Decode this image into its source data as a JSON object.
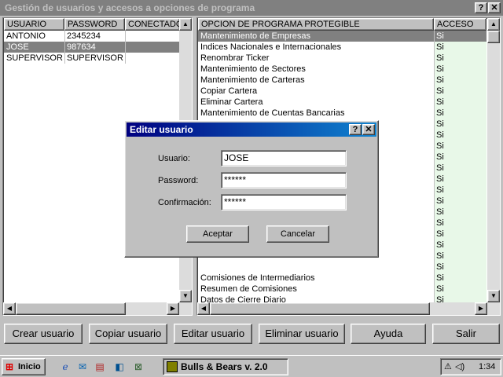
{
  "window": {
    "title": "Gestión de usuarios y accesos a opciones de programa",
    "help_btn": "?",
    "close_btn": "✕"
  },
  "users": {
    "columns": [
      "USUARIO",
      "PASSWORD",
      "CONECTADO"
    ],
    "rows": [
      {
        "user": "ANTONIO",
        "password": "2345234",
        "connected": ""
      },
      {
        "user": "JOSE",
        "password": "987634",
        "connected": ""
      },
      {
        "user": "SUPERVISOR",
        "password": "SUPERVISOR",
        "connected": ""
      }
    ]
  },
  "options": {
    "columns": [
      "OPCION DE PROGRAMA PROTEGIBLE",
      "ACCESO"
    ],
    "rows": [
      {
        "option": "Mantenimiento de Empresas",
        "access": "Si"
      },
      {
        "option": "Indices Nacionales e Internacionales",
        "access": "Si"
      },
      {
        "option": "Renombrar Ticker",
        "access": "Si"
      },
      {
        "option": "Mantenimiento de Sectores",
        "access": "Si"
      },
      {
        "option": "Mantenimiento de Carteras",
        "access": "Si"
      },
      {
        "option": "Copiar Cartera",
        "access": "Si"
      },
      {
        "option": "Eliminar Cartera",
        "access": "Si"
      },
      {
        "option": "Mantenimiento de Cuentas Bancarias",
        "access": "Si"
      },
      {
        "option": "",
        "access": "Si"
      },
      {
        "option": "",
        "access": "Si"
      },
      {
        "option": "",
        "access": "Si"
      },
      {
        "option": "",
        "access": "Si"
      },
      {
        "option": "",
        "access": "Si"
      },
      {
        "option": "",
        "access": "Si"
      },
      {
        "option": "",
        "access": "Si"
      },
      {
        "option": "",
        "access": "Si"
      },
      {
        "option": "",
        "access": "Si"
      },
      {
        "option": "",
        "access": "Si"
      },
      {
        "option": "",
        "access": "Si"
      },
      {
        "option": "",
        "access": "Si"
      },
      {
        "option": "",
        "access": "Si"
      },
      {
        "option": "",
        "access": "Si"
      },
      {
        "option": "Comisiones de Intermediarios",
        "access": "Si"
      },
      {
        "option": "Resumen de Comisiones",
        "access": "Si"
      },
      {
        "option": "Datos de Cierre Diario",
        "access": "Si"
      }
    ]
  },
  "buttons": {
    "create": "Crear usuario",
    "copy": "Copiar usuario",
    "edit": "Editar usuario",
    "delete": "Eliminar usuario",
    "help": "Ayuda",
    "exit": "Salir"
  },
  "dialog": {
    "title": "Editar usuario",
    "help_btn": "?",
    "close_btn": "✕",
    "user_label": "Usuario:",
    "user_value": "JOSE",
    "password_label": "Password:",
    "password_value": "******",
    "confirm_label": "Confirmación:",
    "confirm_value": "******",
    "accept": "Aceptar",
    "cancel": "Cancelar"
  },
  "taskbar": {
    "start": "Inicio",
    "task": "Bulls & Bears v. 2.0",
    "clock": "1:34"
  }
}
